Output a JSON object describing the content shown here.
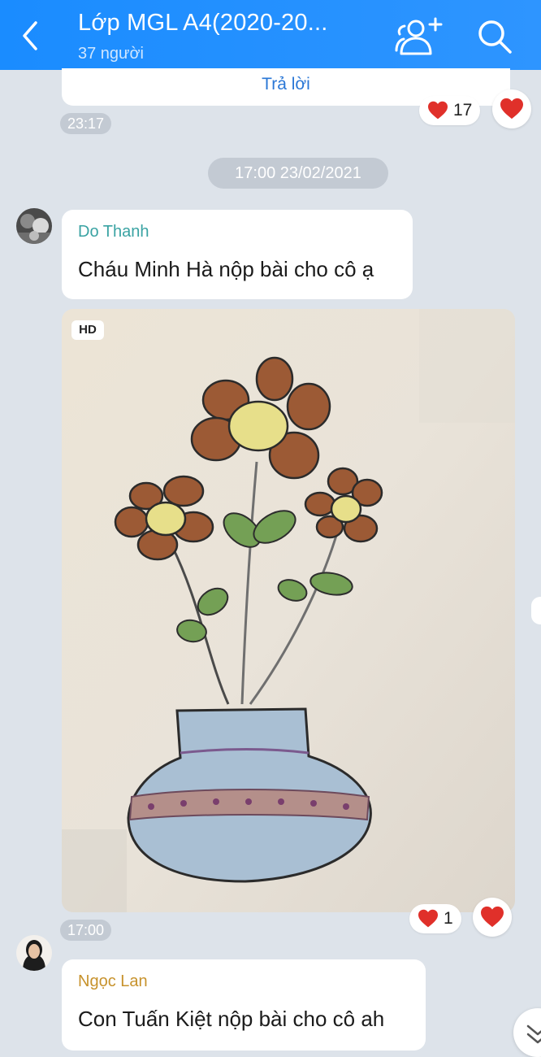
{
  "header": {
    "title": "Lớp MGL A4(2020-20...",
    "member_count": "37 người"
  },
  "previous_message": {
    "reply_label": "Trả lời",
    "reaction_count": "17",
    "time": "23:17"
  },
  "date_separator": "17:00 23/02/2021",
  "messages": [
    {
      "sender": "Do Thanh",
      "sender_color": "#3aa3a3",
      "text": "Cháu Minh Hà nộp bài cho cô ạ",
      "photo_badge": "HD",
      "reaction_count": "1",
      "time": "17:00"
    },
    {
      "sender": "Ngọc Lan",
      "sender_color": "#c7922c",
      "text": "Con Tuấn Kiệt nộp bài cho cô ah"
    }
  ],
  "colors": {
    "header": "#1a8cff",
    "reaction": "#e0302a",
    "background": "#dde3ea"
  }
}
